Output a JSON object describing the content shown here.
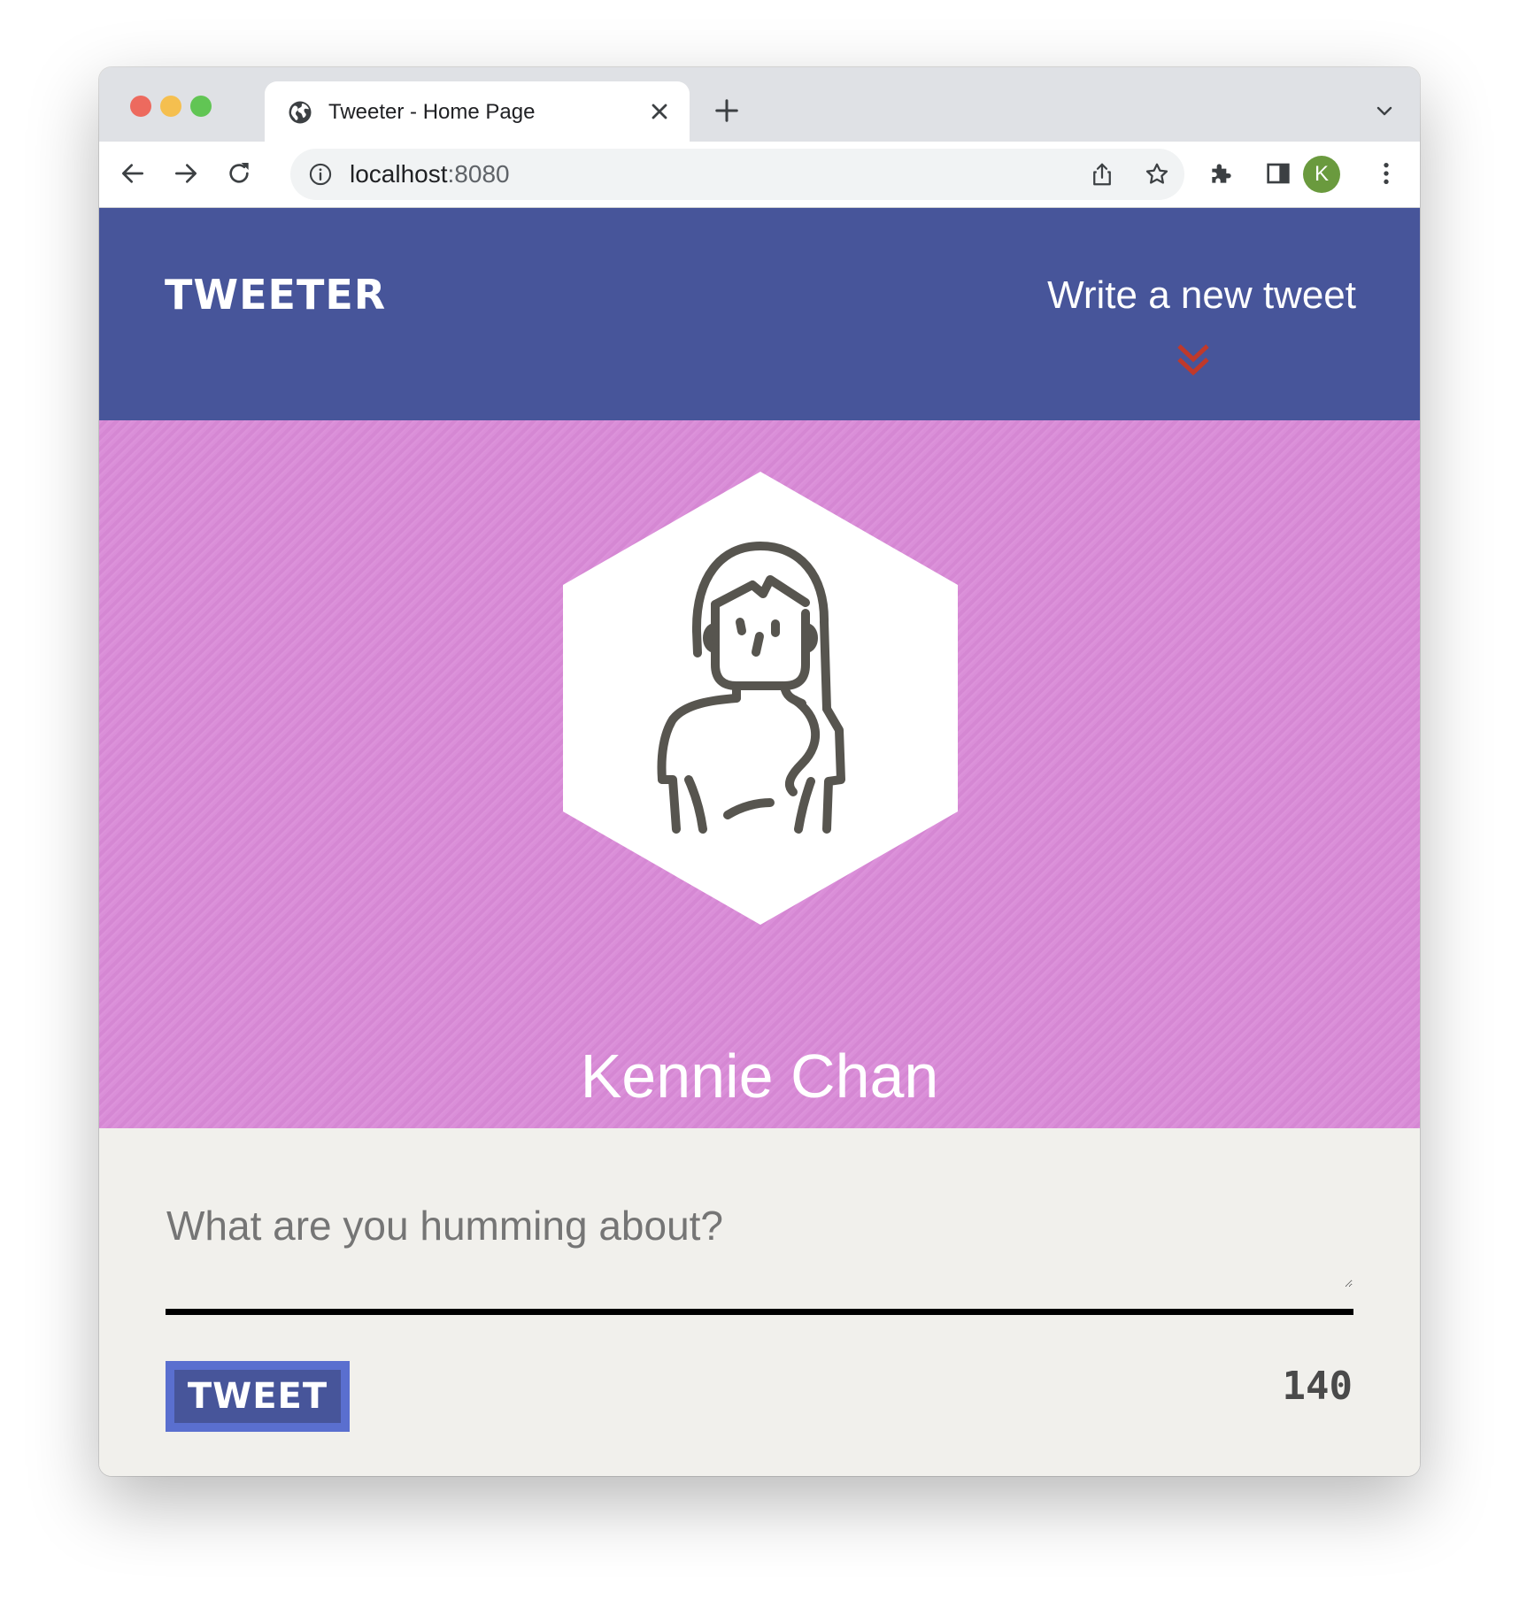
{
  "browser": {
    "tab_title": "Tweeter - Home Page",
    "url_host": "localhost",
    "url_port": ":8080",
    "profile_initial": "K",
    "colors": {
      "close": "#ed6a5e",
      "minimize": "#f5bf4f",
      "maximize": "#61c554",
      "profile": "#6a9a3e"
    }
  },
  "header": {
    "logo": "TWEETER",
    "compose_link": "Write a new tweet",
    "compose_icon": "double-chevron-down-icon",
    "colors": {
      "background": "#47559a",
      "chevron": "#c0392b"
    }
  },
  "profile": {
    "name": "Kennie Chan",
    "avatar": "woman-avatar-icon",
    "colors": {
      "background": "#d98ad7"
    }
  },
  "composer": {
    "placeholder": "What are you humming about?",
    "value": "",
    "submit_label": "TWEET",
    "counter": "140"
  }
}
